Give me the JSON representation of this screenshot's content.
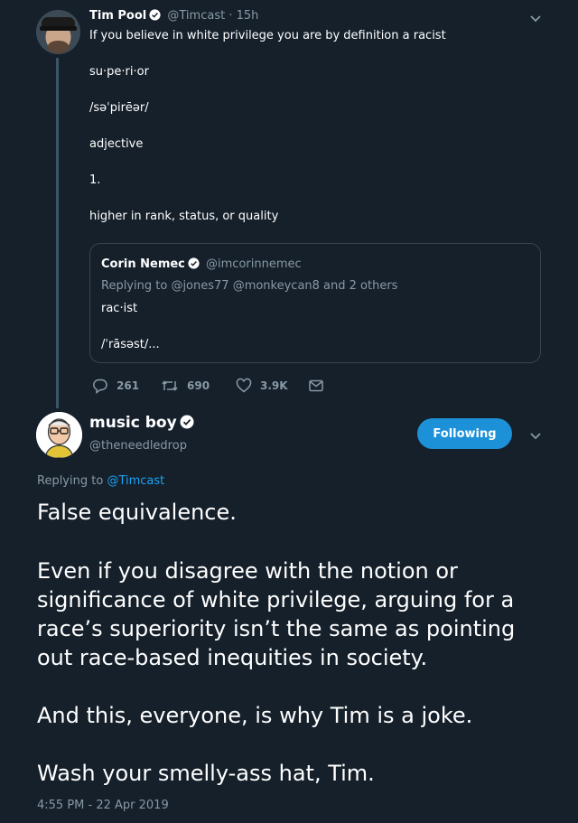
{
  "parent_tweet": {
    "author_name": "Tim Pool",
    "handle": "@Timcast",
    "separator": "·",
    "time_ago": "15h",
    "text_line": "If you believe in white privilege you are by definition a racist",
    "def_word": "su·pe·ri·or",
    "def_pron": "/səˈpirēər/",
    "def_pos": "adjective",
    "def_num": "1.",
    "def_meaning": "higher in rank, status, or quality",
    "quote": {
      "author_name": "Corin Nemec",
      "handle": "@imcorinnemec",
      "replying_prefix": "Replying to",
      "replying_to": "@jones77 @monkeycan8 and 2 others",
      "word": "rac·ist",
      "pron": "/ˈrāsəst/..."
    },
    "actions": {
      "replies": "261",
      "retweets": "690",
      "likes": "3.9K"
    }
  },
  "main_tweet": {
    "author_name": "music boy",
    "handle": "@theneedledrop",
    "follow_label": "Following",
    "replying_prefix": "Replying to",
    "replying_to": "@Timcast",
    "body_1": "False equivalence.",
    "body_2a": "Even if you disagree with the notion or",
    "body_2b": "significance of white privilege, arguing for a",
    "body_2c": "race’s superiority isn’t the same as pointing",
    "body_2d": "out race-based inequities in society.",
    "body_3": "And this, everyone, is why Tim is a joke.",
    "body_4": "Wash your smelly-ass hat, Tim.",
    "timestamp": "4:55 PM - 22 Apr 2019"
  },
  "colors": {
    "background": "#15202b",
    "accent": "#1da1f2",
    "muted": "#8899a6",
    "border": "#38444d"
  },
  "icons": [
    "verified-badge-icon",
    "chevron-down-icon",
    "reply-icon",
    "retweet-icon",
    "like-icon",
    "direct-message-icon"
  ]
}
